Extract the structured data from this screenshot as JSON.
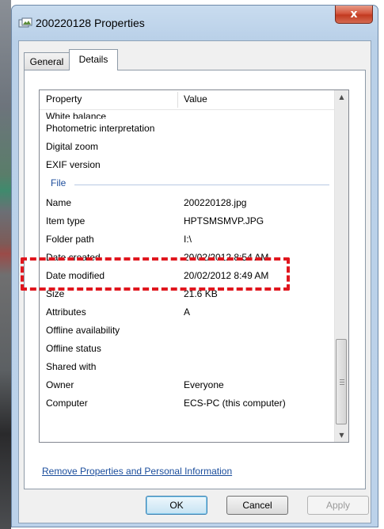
{
  "window": {
    "title": "200220128 Properties",
    "close_label": "x"
  },
  "tabs": [
    {
      "label": "General",
      "active": false
    },
    {
      "label": "Details",
      "active": true
    }
  ],
  "list": {
    "headers": {
      "property": "Property",
      "value": "Value"
    },
    "partial_row": "White balance",
    "rows_top": [
      {
        "property": "Photometric interpretation",
        "value": ""
      },
      {
        "property": "Digital zoom",
        "value": ""
      },
      {
        "property": "EXIF version",
        "value": ""
      }
    ],
    "group_label": "File",
    "rows_file": [
      {
        "property": "Name",
        "value": "200220128.jpg"
      },
      {
        "property": "Item type",
        "value": "HPTSMSMVP.JPG"
      },
      {
        "property": "Folder path",
        "value": "I:\\"
      },
      {
        "property": "Date created",
        "value": "20/02/2012 8:54 AM"
      },
      {
        "property": "Date modified",
        "value": "20/02/2012 8:49 AM"
      },
      {
        "property": "Size",
        "value": "21.6 KB"
      },
      {
        "property": "Attributes",
        "value": "A"
      },
      {
        "property": "Offline availability",
        "value": ""
      },
      {
        "property": "Offline status",
        "value": ""
      },
      {
        "property": "Shared with",
        "value": ""
      },
      {
        "property": "Owner",
        "value": "Everyone"
      },
      {
        "property": "Computer",
        "value": "ECS-PC (this computer)"
      }
    ]
  },
  "link_text": "Remove Properties and Personal Information",
  "buttons": {
    "ok": "OK",
    "cancel": "Cancel",
    "apply": "Apply"
  },
  "colors": {
    "annotation": "#e0161e",
    "link": "#1a4d9c",
    "group": "#1e4e9c"
  }
}
